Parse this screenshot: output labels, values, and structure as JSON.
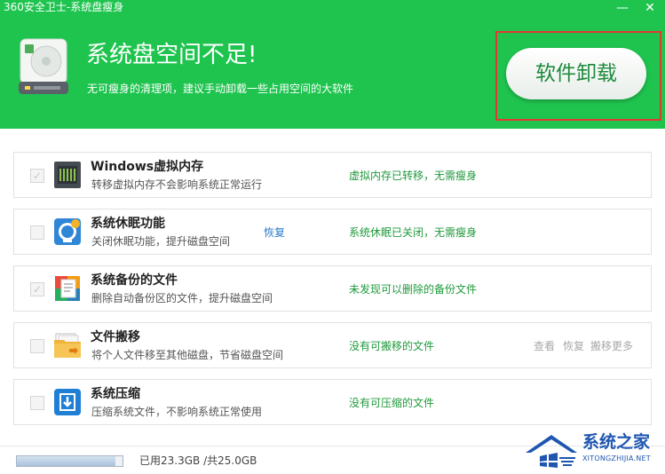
{
  "window": {
    "title": "360安全卫士-系统盘瘦身",
    "minimize_glyph": "—",
    "close_glyph": "✕"
  },
  "header": {
    "title": "系统盘空间不足!",
    "subtitle": "无可瘦身的清理项，建议手动卸载一些占用空间的大软件",
    "uninstall_button": "软件卸载",
    "icon": "hard-disk-icon"
  },
  "items": [
    {
      "title": "Windows虚拟内存",
      "desc": "转移虚拟内存不会影响系统正常运行",
      "status": "虚拟内存已转移，无需瘦身",
      "checked": true,
      "icon": "memory-chip-icon"
    },
    {
      "title": "系统休眠功能",
      "desc": "关闭休眠功能，提升磁盘空间",
      "status": "系统休眠已关闭，无需瘦身",
      "link": "恢复",
      "checked": false,
      "icon": "sleep-monitor-icon"
    },
    {
      "title": "系统备份的文件",
      "desc": "删除自动备份区的文件，提升磁盘空间",
      "status": "未发现可以删除的备份文件",
      "checked": true,
      "icon": "backup-files-icon"
    },
    {
      "title": "文件搬移",
      "desc": "将个人文件移至其他磁盘，节省磁盘空间",
      "status": "没有可搬移的文件",
      "actions": [
        "查看",
        "恢复",
        "搬移更多"
      ],
      "checked": false,
      "icon": "folder-move-icon"
    },
    {
      "title": "系统压缩",
      "desc": "压缩系统文件，不影响系统正常使用",
      "status": "没有可压缩的文件",
      "checked": false,
      "icon": "compress-icon"
    }
  ],
  "footer": {
    "usage": "已用23.3GB /共25.0GB",
    "used_fraction": 0.932
  },
  "watermark": {
    "title": "系统之家",
    "url": "XITONGZHIJIA.NET"
  },
  "colors": {
    "header_green": "#1fc44f",
    "status_green": "#1f9a3b",
    "highlight_red": "#e03a2e",
    "link_blue": "#2a7bc7"
  }
}
